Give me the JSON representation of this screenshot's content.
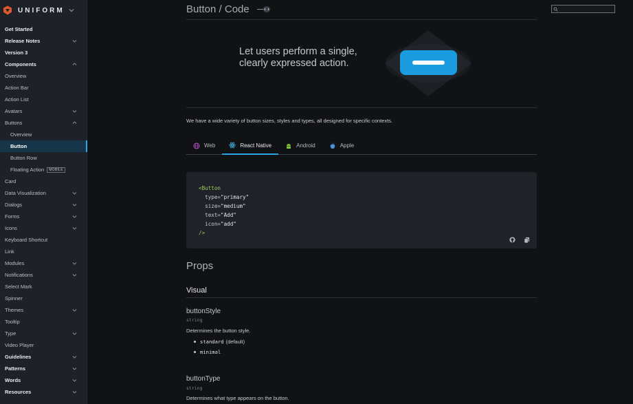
{
  "brand": {
    "name": "UNIFORM",
    "logo_color": "#e0592a"
  },
  "sidebar": {
    "items": [
      {
        "label": "Get Started",
        "bold": true,
        "chevron": ""
      },
      {
        "label": "Release Notes",
        "bold": true,
        "chevron": "down"
      },
      {
        "label": "Version 3",
        "bold": true,
        "chevron": ""
      },
      {
        "label": "Components",
        "bold": true,
        "chevron": "up"
      },
      {
        "label": "Overview",
        "chevron": ""
      },
      {
        "label": "Action Bar",
        "chevron": ""
      },
      {
        "label": "Action List",
        "chevron": ""
      },
      {
        "label": "Avatars",
        "chevron": "down"
      },
      {
        "label": "Buttons",
        "chevron": "up"
      },
      {
        "label": "Overview",
        "sub": true,
        "chevron": ""
      },
      {
        "label": "Button",
        "sub": true,
        "active": true,
        "chevron": ""
      },
      {
        "label": "Button Row",
        "sub": true,
        "chevron": ""
      },
      {
        "label": "Floating Action",
        "sub": true,
        "badge": "MOBILE",
        "chevron": ""
      },
      {
        "label": "Card",
        "chevron": ""
      },
      {
        "label": "Data Visualization",
        "chevron": "down"
      },
      {
        "label": "Dialogs",
        "chevron": "down"
      },
      {
        "label": "Forms",
        "chevron": "down"
      },
      {
        "label": "Icons",
        "chevron": "down"
      },
      {
        "label": "Keyboard Shortcut",
        "chevron": ""
      },
      {
        "label": "Link",
        "chevron": ""
      },
      {
        "label": "Modules",
        "chevron": "down"
      },
      {
        "label": "Notifications",
        "chevron": "down"
      },
      {
        "label": "Select Mark",
        "chevron": ""
      },
      {
        "label": "Spinner",
        "chevron": ""
      },
      {
        "label": "Themes",
        "chevron": "down"
      },
      {
        "label": "Tooltip",
        "chevron": ""
      },
      {
        "label": "Type",
        "chevron": "down"
      },
      {
        "label": "Video Player",
        "chevron": ""
      },
      {
        "label": "Guidelines",
        "bold": true,
        "chevron": "down"
      },
      {
        "label": "Patterns",
        "bold": true,
        "chevron": "down"
      },
      {
        "label": "Words",
        "bold": true,
        "chevron": "down"
      },
      {
        "label": "Resources",
        "bold": true,
        "chevron": "down"
      }
    ]
  },
  "header": {
    "title": "Button / Code",
    "search_placeholder": ""
  },
  "hero": {
    "text": "Let users perform a single, clearly expressed action.",
    "button_color": "#1b9be0"
  },
  "intro": "We have a wide variety of button sizes, styles and types, all designed for specific contexts.",
  "tabs": [
    {
      "label": "Web",
      "icon": "web-icon",
      "active": false
    },
    {
      "label": "React Native",
      "icon": "react-icon",
      "active": true
    },
    {
      "label": "Android",
      "icon": "android-icon",
      "active": false
    },
    {
      "label": "Apple",
      "icon": "apple-icon",
      "active": false
    }
  ],
  "code": {
    "lines": [
      [
        {
          "t": "tag",
          "v": "<Button"
        }
      ],
      [
        {
          "t": "attr",
          "v": "  type="
        },
        {
          "t": "str",
          "v": "\"primary\""
        }
      ],
      [
        {
          "t": "attr",
          "v": "  size="
        },
        {
          "t": "str",
          "v": "\"medium\""
        }
      ],
      [
        {
          "t": "attr",
          "v": "  text="
        },
        {
          "t": "str",
          "v": "\"Add\""
        }
      ],
      [
        {
          "t": "attr",
          "v": "  icon="
        },
        {
          "t": "str",
          "v": "\"add\""
        }
      ],
      [
        {
          "t": "tag",
          "v": "/>"
        }
      ]
    ]
  },
  "props": {
    "heading": "Props",
    "section": "Visual",
    "items": [
      {
        "name": "buttonStyle",
        "type": "string",
        "description": "Determines the button style.",
        "options": [
          {
            "code": "standard",
            "note": "(default)"
          },
          {
            "code": "minimal",
            "note": ""
          }
        ]
      },
      {
        "name": "buttonType",
        "type": "string",
        "description": "Determines what type appears on the button.",
        "options": []
      }
    ]
  }
}
